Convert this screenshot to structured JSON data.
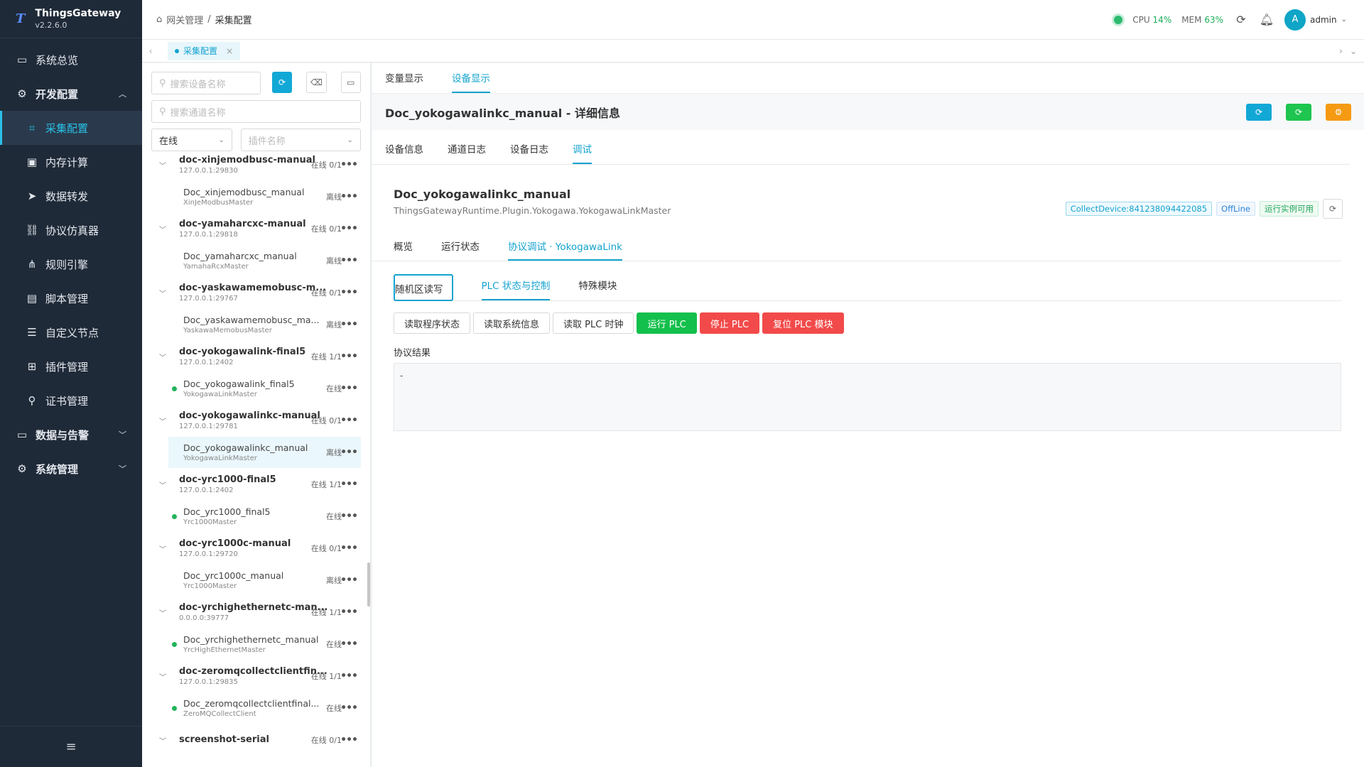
{
  "brand": {
    "logo": "T",
    "name": "ThingsGateway",
    "version": "v2.2.6.0"
  },
  "sidebar": {
    "items": [
      {
        "label": "系统总览",
        "icon": "monitor-icon",
        "type": "top"
      },
      {
        "label": "开发配置",
        "icon": "gear-icon",
        "type": "group",
        "arrow": "up"
      },
      {
        "label": "采集配置",
        "icon": "chart-icon",
        "type": "sub",
        "active": true
      },
      {
        "label": "内存计算",
        "icon": "chip-icon",
        "type": "sub"
      },
      {
        "label": "数据转发",
        "icon": "send-icon",
        "type": "sub"
      },
      {
        "label": "协议仿真器",
        "icon": "link-icon",
        "type": "sub"
      },
      {
        "label": "规则引擎",
        "icon": "share-icon",
        "type": "sub"
      },
      {
        "label": "脚本管理",
        "icon": "file-icon",
        "type": "sub"
      },
      {
        "label": "自定义节点",
        "icon": "sliders-icon",
        "type": "sub"
      },
      {
        "label": "插件管理",
        "icon": "plugin-icon",
        "type": "sub"
      },
      {
        "label": "证书管理",
        "icon": "certificate-icon",
        "type": "sub"
      },
      {
        "label": "数据与告警",
        "icon": "monitor-icon",
        "type": "group",
        "arrow": "down"
      },
      {
        "label": "系统管理",
        "icon": "gear-icon",
        "type": "group",
        "arrow": "down"
      }
    ]
  },
  "header": {
    "breadcrumb": [
      "网关管理",
      "采集配置"
    ],
    "cpu_label": "CPU",
    "cpu_value": "14%",
    "mem_label": "MEM",
    "mem_value": "63%",
    "avatar": "A",
    "user": "admin"
  },
  "tabbar": {
    "tab_label": "采集配置"
  },
  "left": {
    "device_search_placeholder": "搜索设备名称",
    "channel_search_placeholder": "搜索通道名称",
    "status_select": "在线",
    "plugin_placeholder": "插件名称",
    "tree": [
      {
        "type": "group",
        "name": "doc-xinjemodbusc-manual",
        "ip": "127.0.0.1:29830",
        "status": "在线 0/1"
      },
      {
        "type": "device",
        "name": "Doc_xinjemodbusc_manual",
        "driver": "XinJeModbusMaster",
        "status": "离线",
        "online": false
      },
      {
        "type": "group",
        "name": "doc-yamaharcxc-manual",
        "ip": "127.0.0.1:29818",
        "status": "在线 0/1"
      },
      {
        "type": "device",
        "name": "Doc_yamaharcxc_manual",
        "driver": "YamahaRcxMaster",
        "status": "离线",
        "online": false
      },
      {
        "type": "group",
        "name": "doc-yaskawamemobusc-m...",
        "ip": "127.0.0.1:29767",
        "status": "在线 0/1"
      },
      {
        "type": "device",
        "name": "Doc_yaskawamemobusc_ma...",
        "driver": "YaskawaMemobusMaster",
        "status": "离线",
        "online": false
      },
      {
        "type": "group",
        "name": "doc-yokogawalink-final5",
        "ip": "127.0.0.1:2402",
        "status": "在线 1/1"
      },
      {
        "type": "device",
        "name": "Doc_yokogawalink_final5",
        "driver": "YokogawaLinkMaster",
        "status": "在线",
        "online": true
      },
      {
        "type": "group",
        "name": "doc-yokogawalinkc-manual",
        "ip": "127.0.0.1:29781",
        "status": "在线 0/1"
      },
      {
        "type": "device",
        "name": "Doc_yokogawalinkc_manual",
        "driver": "YokogawaLinkMaster",
        "status": "离线",
        "online": false,
        "selected": true
      },
      {
        "type": "group",
        "name": "doc-yrc1000-final5",
        "ip": "127.0.0.1:2402",
        "status": "在线 1/1"
      },
      {
        "type": "device",
        "name": "Doc_yrc1000_final5",
        "driver": "Yrc1000Master",
        "status": "在线",
        "online": true
      },
      {
        "type": "group",
        "name": "doc-yrc1000c-manual",
        "ip": "127.0.0.1:29720",
        "status": "在线 0/1"
      },
      {
        "type": "device",
        "name": "Doc_yrc1000c_manual",
        "driver": "Yrc1000Master",
        "status": "离线",
        "online": false
      },
      {
        "type": "group",
        "name": "doc-yrchighethernetc-man...",
        "ip": "0.0.0.0:39777",
        "status": "在线 1/1"
      },
      {
        "type": "device",
        "name": "Doc_yrchighethernetc_manual",
        "driver": "YrcHighEthernetMaster",
        "status": "在线",
        "online": true
      },
      {
        "type": "group",
        "name": "doc-zeromqcollectclientfin...",
        "ip": "127.0.0.1:29835",
        "status": "在线 1/1"
      },
      {
        "type": "device",
        "name": "Doc_zeromqcollectclientfinal...",
        "driver": "ZeroMQCollectClient",
        "status": "在线",
        "online": true
      },
      {
        "type": "group",
        "name": "screenshot-serial",
        "ip": "",
        "status": "在线 0/1"
      }
    ]
  },
  "main": {
    "top_tabs": [
      "变量显示",
      "设备显示"
    ],
    "detail_title": "Doc_yokogawalinkc_manual - 详细信息",
    "detail_buttons": [
      {
        "color": "#12a8d6",
        "icon": "refresh-icon"
      },
      {
        "color": "#1ec54f",
        "icon": "refresh-icon"
      },
      {
        "color": "#f59a12",
        "icon": "settings-icon"
      }
    ],
    "sub_tabs": [
      "设备信息",
      "通道日志",
      "设备日志",
      "调试"
    ],
    "device_name": "Doc_yokogawalinkc_manual",
    "plugin": "ThingsGatewayRuntime.Plugin.Yokogawa.YokogawaLinkMaster",
    "badges": [
      "CollectDevice:841238094422085",
      "OffLine",
      "运行实例可用"
    ],
    "inner_tabs": [
      "概览",
      "运行状态",
      "协议调试 · YokogawaLink"
    ],
    "seg_tabs": [
      "随机区读写",
      "PLC 状态与控制",
      "特殊模块"
    ],
    "actions": [
      {
        "label": "读取程序状态",
        "style": "default"
      },
      {
        "label": "读取系统信息",
        "style": "default"
      },
      {
        "label": "读取 PLC 时钟",
        "style": "default"
      },
      {
        "label": "运行 PLC",
        "style": "green"
      },
      {
        "label": "停止 PLC",
        "style": "red"
      },
      {
        "label": "复位 PLC 模块",
        "style": "red"
      }
    ],
    "result_label": "协议结果",
    "result_value": "-"
  }
}
